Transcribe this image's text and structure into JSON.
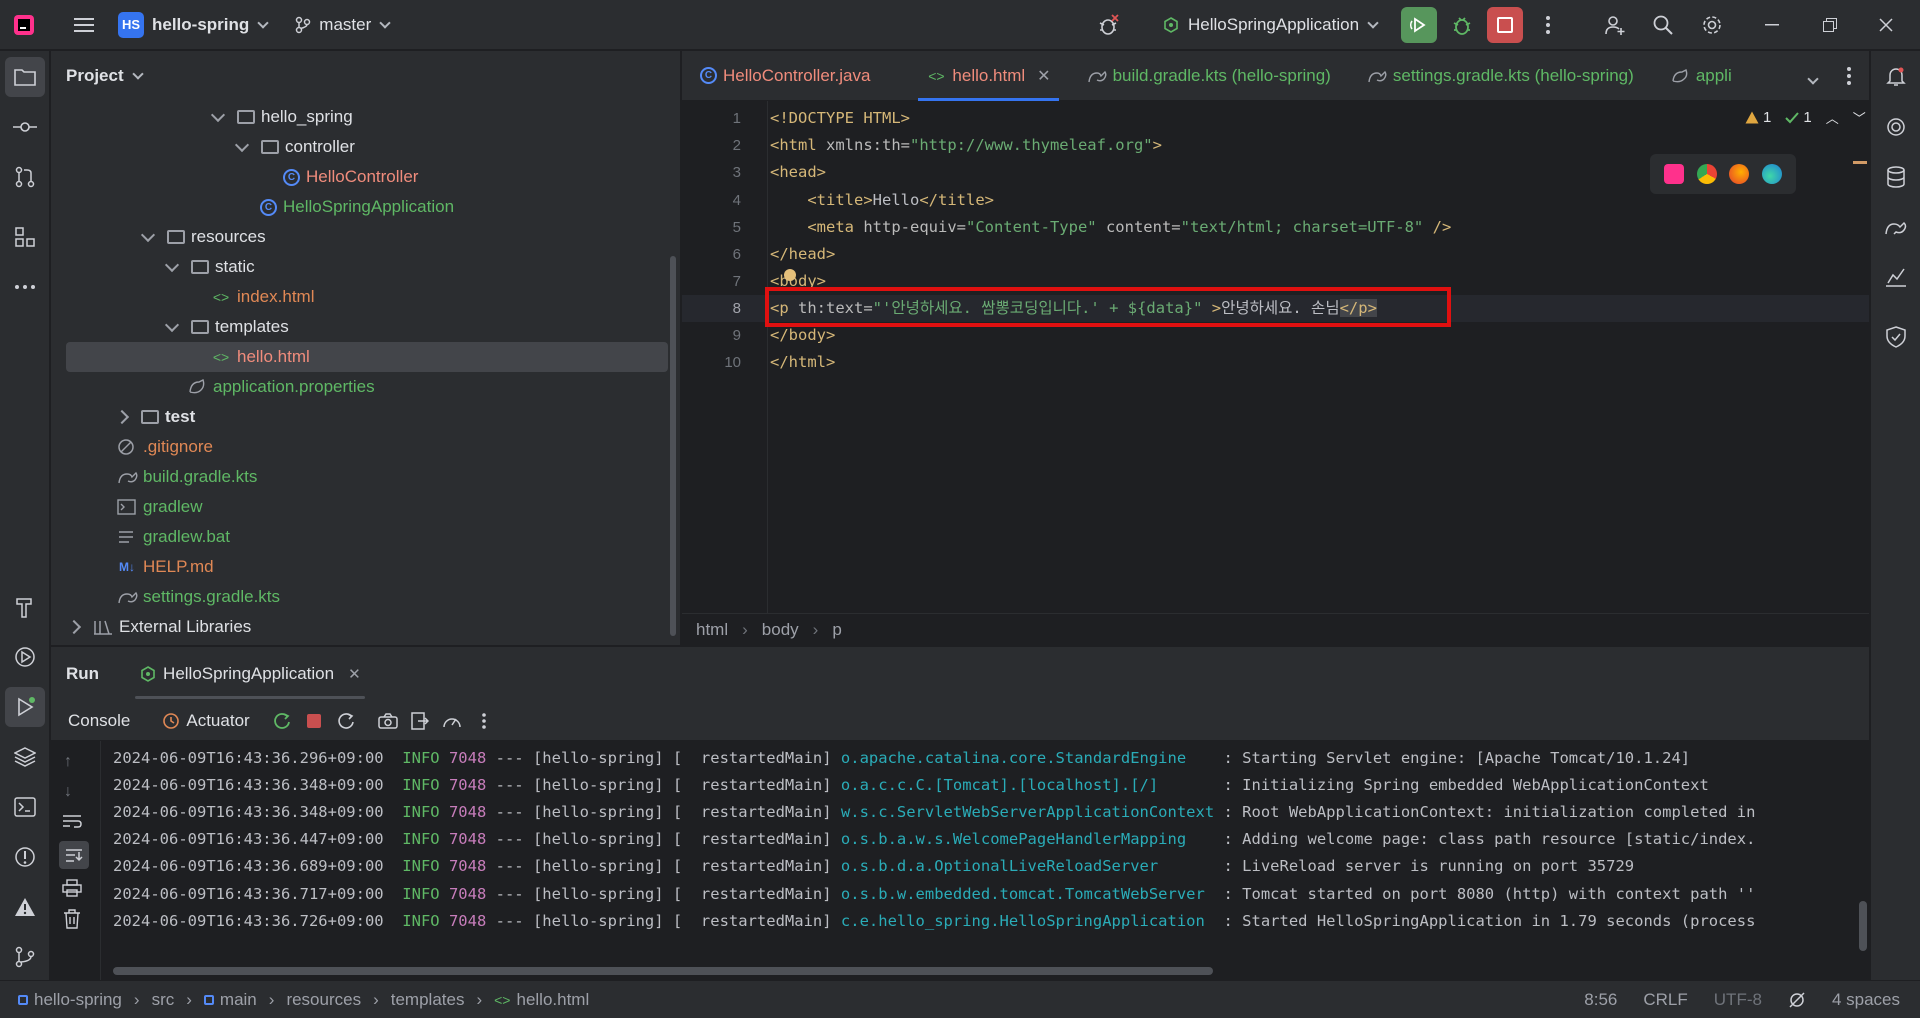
{
  "titlebar": {
    "project_badge": "HS",
    "project_name": "hello-spring",
    "branch": "master",
    "run_config": "HelloSpringApplication"
  },
  "project_panel": {
    "title": "Project",
    "items": [
      {
        "label": "hello_spring",
        "kind": "package"
      },
      {
        "label": "controller",
        "kind": "package"
      },
      {
        "label": "HelloController",
        "kind": "class"
      },
      {
        "label": "HelloSpringApplication",
        "kind": "spring-class"
      },
      {
        "label": "resources",
        "kind": "folder"
      },
      {
        "label": "static",
        "kind": "folder"
      },
      {
        "label": "index.html",
        "kind": "html"
      },
      {
        "label": "templates",
        "kind": "folder"
      },
      {
        "label": "hello.html",
        "kind": "html"
      },
      {
        "label": "application.properties",
        "kind": "properties"
      },
      {
        "label": "test",
        "kind": "folder"
      },
      {
        "label": ".gitignore",
        "kind": "ignore"
      },
      {
        "label": "build.gradle.kts",
        "kind": "gradle"
      },
      {
        "label": "gradlew",
        "kind": "script"
      },
      {
        "label": "gradlew.bat",
        "kind": "text"
      },
      {
        "label": "HELP.md",
        "kind": "markdown"
      },
      {
        "label": "settings.gradle.kts",
        "kind": "gradle"
      },
      {
        "label": "External Libraries",
        "kind": "library"
      }
    ]
  },
  "editor": {
    "tabs": [
      {
        "label": "HelloController.java"
      },
      {
        "label": "hello.html"
      },
      {
        "label": "build.gradle.kts (hello-spring)"
      },
      {
        "label": "settings.gradle.kts (hello-spring)"
      },
      {
        "label": "appli"
      }
    ],
    "line_numbers": [
      "1",
      "2",
      "3",
      "4",
      "5",
      "6",
      "7",
      "8",
      "9",
      "10"
    ],
    "lines": {
      "l1": "<!DOCTYPE HTML>",
      "l2a": "<html ",
      "l2b": "xmlns:th=",
      "l2c": "\"http://www.thymeleaf.org\"",
      "l2d": ">",
      "l3": "<head>",
      "l4a": "    <title>",
      "l4b": "Hello",
      "l4c": "</title>",
      "l5a": "    <meta ",
      "l5b": "http-equiv=",
      "l5c": "\"Content-Type\"",
      "l5d": " content=",
      "l5e": "\"text/html; charset=UTF-8\"",
      "l5f": " />",
      "l6": "</head>",
      "l7": "<body>",
      "l8a": "<p ",
      "l8b": "th:text=",
      "l8c": "\"'안녕하세요. 쌈뽕코딩입니다.' + ${data}\"",
      "l8d": " >",
      "l8e": "안녕하세요. 손님",
      "l8f": "</p>",
      "l9": "</body>",
      "l10": "</html>"
    },
    "inspection": {
      "warnings": "1",
      "ok": "1"
    },
    "breadcrumb": [
      "html",
      "body",
      "p"
    ]
  },
  "run_panel": {
    "title": "Run",
    "config_tab": "HelloSpringApplication",
    "console_tab": "Console",
    "actuator_tab": "Actuator",
    "logs": [
      {
        "ts": "2024-06-09T16:43:36.296+09:00",
        "level": "INFO",
        "pid": "7048",
        "mid": " --- [hello-spring] [  restartedMain] ",
        "logger": "o.apache.catalina.core.StandardEngine   ",
        "msg": " : Starting Servlet engine: [Apache Tomcat/10.1.24]"
      },
      {
        "ts": "2024-06-09T16:43:36.348+09:00",
        "level": "INFO",
        "pid": "7048",
        "mid": " --- [hello-spring] [  restartedMain] ",
        "logger": "o.a.c.c.C.[Tomcat].[localhost].[/]      ",
        "msg": " : Initializing Spring embedded WebApplicationContext"
      },
      {
        "ts": "2024-06-09T16:43:36.348+09:00",
        "level": "INFO",
        "pid": "7048",
        "mid": " --- [hello-spring] [  restartedMain] ",
        "logger": "w.s.c.ServletWebServerApplicationContext",
        "msg": " : Root WebApplicationContext: initialization completed in"
      },
      {
        "ts": "2024-06-09T16:43:36.447+09:00",
        "level": "INFO",
        "pid": "7048",
        "mid": " --- [hello-spring] [  restartedMain] ",
        "logger": "o.s.b.a.w.s.WelcomePageHandlerMapping   ",
        "msg": " : Adding welcome page: class path resource [static/index."
      },
      {
        "ts": "2024-06-09T16:43:36.689+09:00",
        "level": "INFO",
        "pid": "7048",
        "mid": " --- [hello-spring] [  restartedMain] ",
        "logger": "o.s.b.d.a.OptionalLiveReloadServer      ",
        "msg": " : LiveReload server is running on port 35729"
      },
      {
        "ts": "2024-06-09T16:43:36.717+09:00",
        "level": "INFO",
        "pid": "7048",
        "mid": " --- [hello-spring] [  restartedMain] ",
        "logger": "o.s.b.w.embedded.tomcat.TomcatWebServer ",
        "msg": " : Tomcat started on port 8080 (http) with context path ''"
      },
      {
        "ts": "2024-06-09T16:43:36.726+09:00",
        "level": "INFO",
        "pid": "7048",
        "mid": " --- [hello-spring] [  restartedMain] ",
        "logger": "c.e.hello_spring.HelloSpringApplication ",
        "msg": " : Started HelloSpringApplication in 1.79 seconds (process"
      }
    ]
  },
  "statusbar": {
    "crumbs": [
      "hello-spring",
      "src",
      "main",
      "resources",
      "templates",
      "hello.html"
    ],
    "position": "8:56",
    "line_sep": "CRLF",
    "encoding": "UTF-8",
    "indent": "4 spaces"
  }
}
